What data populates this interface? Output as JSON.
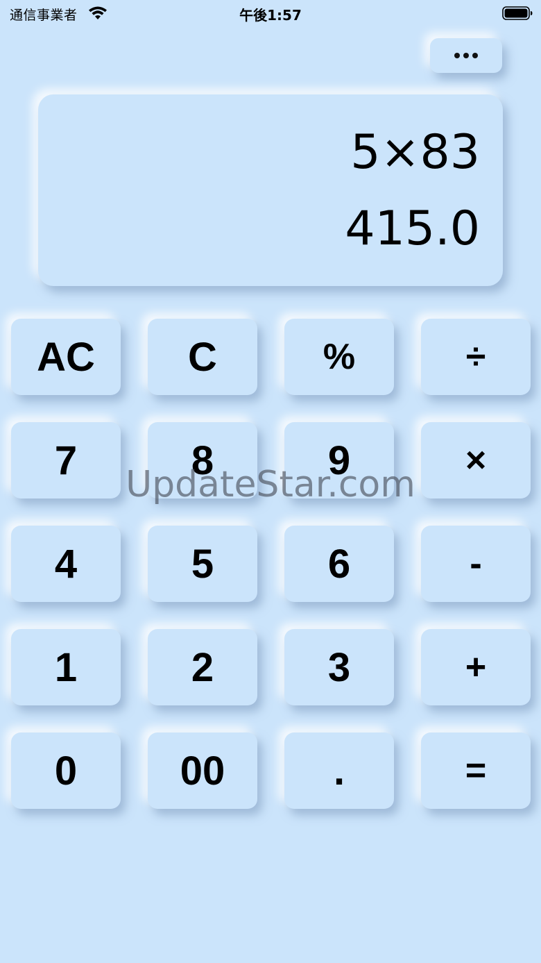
{
  "status_bar": {
    "carrier": "通信事業者",
    "time": "午後1:57",
    "wifi_icon": "wifi-icon",
    "battery_icon": "battery-icon"
  },
  "menu": {
    "icon": "more-horizontal-icon"
  },
  "display": {
    "expression": "5×83",
    "result": "415.0"
  },
  "keys": [
    [
      "AC",
      "C",
      "%",
      "÷"
    ],
    [
      "7",
      "8",
      "9",
      "×"
    ],
    [
      "4",
      "5",
      "6",
      "-"
    ],
    [
      "1",
      "2",
      "3",
      "+"
    ],
    [
      "0",
      "00",
      ".",
      "="
    ]
  ],
  "colors": {
    "background": "#cbe4fb",
    "text": "#000000"
  },
  "watermark": "UpdateStar.com"
}
